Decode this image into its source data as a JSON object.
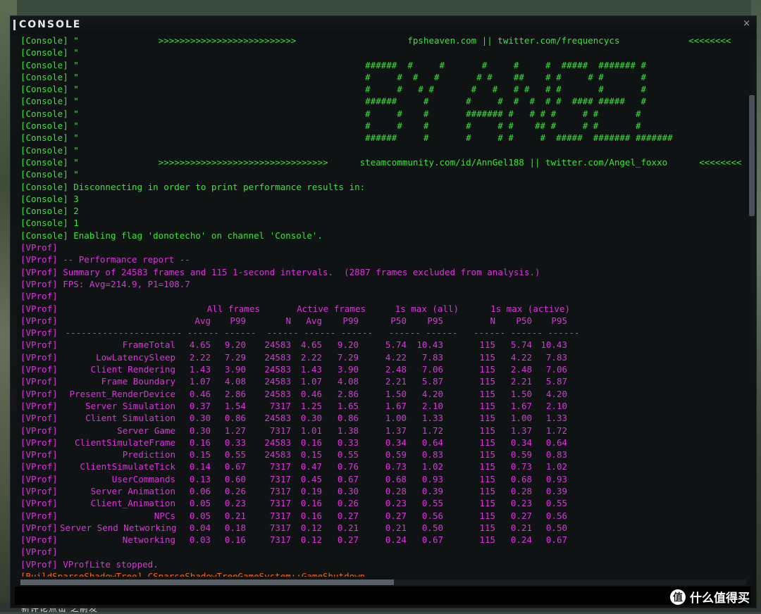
{
  "window": {
    "title": "CONSOLE",
    "close_icon": "×"
  },
  "console_lines": [
    {
      "tag": "[Console]",
      "text": " \"               >>>>>>>>>>>>>>>>>>>>>>>>>>                     fpsheaven.com || twitter.com/frequencycs             <<<<<<<<",
      "color": "g"
    },
    {
      "tag": "[Console]",
      "text": " \"",
      "color": "g"
    },
    {
      "tag": "[Console]",
      "text": " \"                                                      ######  #     #       #     #     #  #####  ####### #",
      "color": "g"
    },
    {
      "tag": "[Console]",
      "text": " \"                                                      #     #  #   #       # #    ##    # #     # #       #",
      "color": "g"
    },
    {
      "tag": "[Console]",
      "text": " \"                                                      #     #   # #       #   #   # #   # #       #       #",
      "color": "g"
    },
    {
      "tag": "[Console]",
      "text": " \"                                                      ######     #       #     #  #  #  # #  #### #####   #",
      "color": "g"
    },
    {
      "tag": "[Console]",
      "text": " \"                                                      #     #    #       ####### #   # # #     # #       #",
      "color": "g"
    },
    {
      "tag": "[Console]",
      "text": " \"                                                      #     #    #       #     # #    ## #     # #       #",
      "color": "g"
    },
    {
      "tag": "[Console]",
      "text": " \"                                                      ######     #       #     # #     #  #####  ####### #######",
      "color": "g"
    },
    {
      "tag": "[Console]",
      "text": " \"",
      "color": "g"
    },
    {
      "tag": "[Console]",
      "text": " \"               >>>>>>>>>>>>>>>>>>>>>>>>>>>>>>>>      steamcommunity.com/id/AnnGel188 || twitter.com/Angel_foxxo      <<<<<<<<",
      "color": "g"
    },
    {
      "tag": "[Console]",
      "text": " \"",
      "color": "g"
    },
    {
      "tag": "[Console]",
      "text": " Disconnecting in order to print performance results in:",
      "color": "g"
    },
    {
      "tag": "[Console]",
      "text": " 3",
      "color": "g"
    },
    {
      "tag": "[Console]",
      "text": " 2",
      "color": "g"
    },
    {
      "tag": "[Console]",
      "text": " 1",
      "color": "g"
    },
    {
      "tag": "[Console]",
      "text": " Enabling flag 'donotecho' on channel 'Console'.",
      "color": "g"
    },
    {
      "tag": "[VProf]",
      "text": "",
      "color": "m"
    },
    {
      "tag": "[VProf]",
      "text": " -- Performance report --",
      "color": "m"
    },
    {
      "tag": "[VProf]",
      "text": " Summary of 24583 frames and 115 1-second intervals.  (2887 frames excluded from analysis.)",
      "color": "m"
    },
    {
      "tag": "[VProf]",
      "text": " FPS: Avg=214.9, P1=108.7",
      "color": "m"
    },
    {
      "tag": "[VProf]",
      "text": "",
      "color": "m"
    }
  ],
  "vprof_tag": "[VProf]",
  "table": {
    "groups": {
      "all": "All frames",
      "active": "Active frames",
      "max_all": "1s max (all)",
      "max_active": "1s max (active)"
    },
    "columns": [
      "Avg",
      "P99",
      "N",
      "Avg",
      "P99",
      "P50",
      "P95",
      "N",
      "P50",
      "P95"
    ],
    "separator": " ---------------------- ------ ------  ------ ------ ------   ------ ------   ------ ------ ------",
    "rows": [
      {
        "name": "FrameTotal",
        "v": [
          "4.65",
          "9.20",
          "24583",
          "4.65",
          "9.20",
          "5.74",
          "10.43",
          "115",
          "5.74",
          "10.43"
        ]
      },
      {
        "name": "LowLatencySleep",
        "v": [
          "2.22",
          "7.29",
          "24583",
          "2.22",
          "7.29",
          "4.22",
          "7.83",
          "115",
          "4.22",
          "7.83"
        ]
      },
      {
        "name": "Client Rendering",
        "v": [
          "1.43",
          "3.90",
          "24583",
          "1.43",
          "3.90",
          "2.48",
          "7.06",
          "115",
          "2.48",
          "7.06"
        ]
      },
      {
        "name": "Frame Boundary",
        "v": [
          "1.07",
          "4.08",
          "24583",
          "1.07",
          "4.08",
          "2.21",
          "5.87",
          "115",
          "2.21",
          "5.87"
        ]
      },
      {
        "name": "Present_RenderDevice",
        "v": [
          "0.46",
          "2.86",
          "24583",
          "0.46",
          "2.86",
          "1.50",
          "4.20",
          "115",
          "1.50",
          "4.20"
        ]
      },
      {
        "name": "Server Simulation",
        "v": [
          "0.37",
          "1.54",
          "7317",
          "1.25",
          "1.65",
          "1.67",
          "2.10",
          "115",
          "1.67",
          "2.10"
        ]
      },
      {
        "name": "Client Simulation",
        "v": [
          "0.30",
          "0.86",
          "24583",
          "0.30",
          "0.86",
          "1.00",
          "1.33",
          "115",
          "1.00",
          "1.33"
        ]
      },
      {
        "name": "Server Game",
        "v": [
          "0.30",
          "1.27",
          "7317",
          "1.01",
          "1.38",
          "1.37",
          "1.72",
          "115",
          "1.37",
          "1.72"
        ]
      },
      {
        "name": "ClientSimulateFrame",
        "v": [
          "0.16",
          "0.33",
          "24583",
          "0.16",
          "0.33",
          "0.34",
          "0.64",
          "115",
          "0.34",
          "0.64"
        ]
      },
      {
        "name": "Prediction",
        "v": [
          "0.15",
          "0.55",
          "24583",
          "0.15",
          "0.55",
          "0.59",
          "0.83",
          "115",
          "0.59",
          "0.83"
        ]
      },
      {
        "name": "ClientSimulateTick",
        "v": [
          "0.14",
          "0.67",
          "7317",
          "0.47",
          "0.76",
          "0.73",
          "1.02",
          "115",
          "0.73",
          "1.02"
        ]
      },
      {
        "name": "UserCommands",
        "v": [
          "0.13",
          "0.60",
          "7317",
          "0.45",
          "0.67",
          "0.68",
          "0.93",
          "115",
          "0.68",
          "0.93"
        ]
      },
      {
        "name": "Server Animation",
        "v": [
          "0.06",
          "0.26",
          "7317",
          "0.19",
          "0.30",
          "0.28",
          "0.39",
          "115",
          "0.28",
          "0.39"
        ]
      },
      {
        "name": "Client_Animation",
        "v": [
          "0.05",
          "0.23",
          "7317",
          "0.16",
          "0.26",
          "0.23",
          "0.55",
          "115",
          "0.23",
          "0.55"
        ]
      },
      {
        "name": "NPCs",
        "v": [
          "0.05",
          "0.21",
          "7317",
          "0.16",
          "0.27",
          "0.27",
          "0.56",
          "115",
          "0.27",
          "0.56"
        ]
      },
      {
        "name": "Server Send Networking",
        "v": [
          "0.04",
          "0.18",
          "7317",
          "0.12",
          "0.21",
          "0.21",
          "0.50",
          "115",
          "0.21",
          "0.50"
        ]
      },
      {
        "name": "Networking",
        "v": [
          "0.03",
          "0.16",
          "7317",
          "0.12",
          "0.27",
          "0.24",
          "0.67",
          "115",
          "0.24",
          "0.67"
        ]
      }
    ]
  },
  "tail_lines": [
    {
      "tag": "[VProf]",
      "text": "",
      "color": "m"
    },
    {
      "tag": "[VProf]",
      "text": " VProfLite stopped.",
      "color": "m"
    },
    {
      "tag": "[BuildSparseShadowTree]",
      "text": " CSparseShadowTreeGameSystem::GameShutdown",
      "color": "o"
    }
  ],
  "background_text": "新评论点击 之前发",
  "watermark": {
    "text": "什么值得买",
    "icon": "值"
  },
  "colors": {
    "console_green": "#37e63a",
    "vprof_magenta": "#dc34dc",
    "warning_orange": "#f06a20"
  }
}
